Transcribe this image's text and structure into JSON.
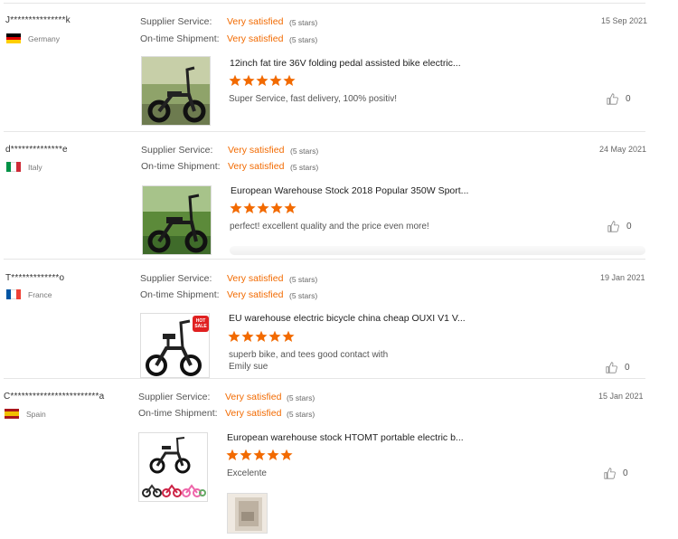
{
  "colors": {
    "accent": "#f26a00",
    "star": "#f26a00",
    "divider": "#e6e6e6",
    "muted": "#777777"
  },
  "reviews": [
    {
      "buyer": "J***************k",
      "country": "Germany",
      "flag_colors": [
        "#000000",
        "#dd0000",
        "#ffce00"
      ],
      "supplier_service_label": "Supplier Service:",
      "supplier_service_value": "Very satisfied",
      "supplier_service_stars": "(5 stars)",
      "shipment_label": "On-time Shipment:",
      "shipment_value": "Very satisfied",
      "shipment_stars": "(5 stars)",
      "date": "15 Sep 2021",
      "product_title": "12inch fat tire 36V folding pedal assisted bike electric...",
      "product_image_icon": "bike-photo-icon",
      "rating": 5,
      "comment": "Super Service, fast delivery, 100% positiv!",
      "helpful_count": "0"
    },
    {
      "buyer": "d**************e",
      "country": "Italy",
      "flag_colors": [
        "#009246",
        "#ffffff",
        "#ce2b37"
      ],
      "supplier_service_label": "Supplier Service:",
      "supplier_service_value": "Very satisfied",
      "supplier_service_stars": "(5 stars)",
      "shipment_label": "On-time Shipment:",
      "shipment_value": "Very satisfied",
      "shipment_stars": "(5 stars)",
      "date": "24 May 2021",
      "product_title": "European Warehouse Stock 2018 Popular 350W Sport...",
      "product_image_icon": "bike-photo-icon",
      "rating": 5,
      "comment": "perfect!  excellent quality and the price even more!",
      "helpful_count": "0"
    },
    {
      "buyer": "T*************o",
      "country": "France",
      "flag_colors": [
        "#0055a4",
        "#ffffff",
        "#ef4135"
      ],
      "supplier_service_label": "Supplier Service:",
      "supplier_service_value": "Very satisfied",
      "supplier_service_stars": "(5 stars)",
      "shipment_label": "On-time Shipment:",
      "shipment_value": "Very satisfied",
      "shipment_stars": "(5 stars)",
      "date": "19 Jan 2021",
      "product_title": "EU warehouse electric bicycle china cheap OUXI V1 V...",
      "product_image_icon": "bike-photo-icon",
      "badge": "HOT SALE",
      "rating": 5,
      "comment_lines": [
        "superb bike, and tees good contact with",
        "Emily sue"
      ],
      "helpful_count": "0"
    },
    {
      "buyer": "C************************a",
      "country": "Spain",
      "flag_colors": [
        "#aa151b",
        "#f1bf00",
        "#aa151b"
      ],
      "supplier_service_label": "Supplier Service:",
      "supplier_service_value": "Very satisfied",
      "supplier_service_stars": "(5 stars)",
      "shipment_label": "On-time Shipment:",
      "shipment_value": "Very satisfied",
      "shipment_stars": "(5 stars)",
      "date": "15 Jan 2021",
      "product_title": "European warehouse stock HTOMT portable electric b...",
      "product_image_icon": "bike-photo-icon",
      "rating": 5,
      "comment": "Excelente",
      "helpful_count": "0",
      "attachment_icon": "review-photo-icon"
    }
  ]
}
